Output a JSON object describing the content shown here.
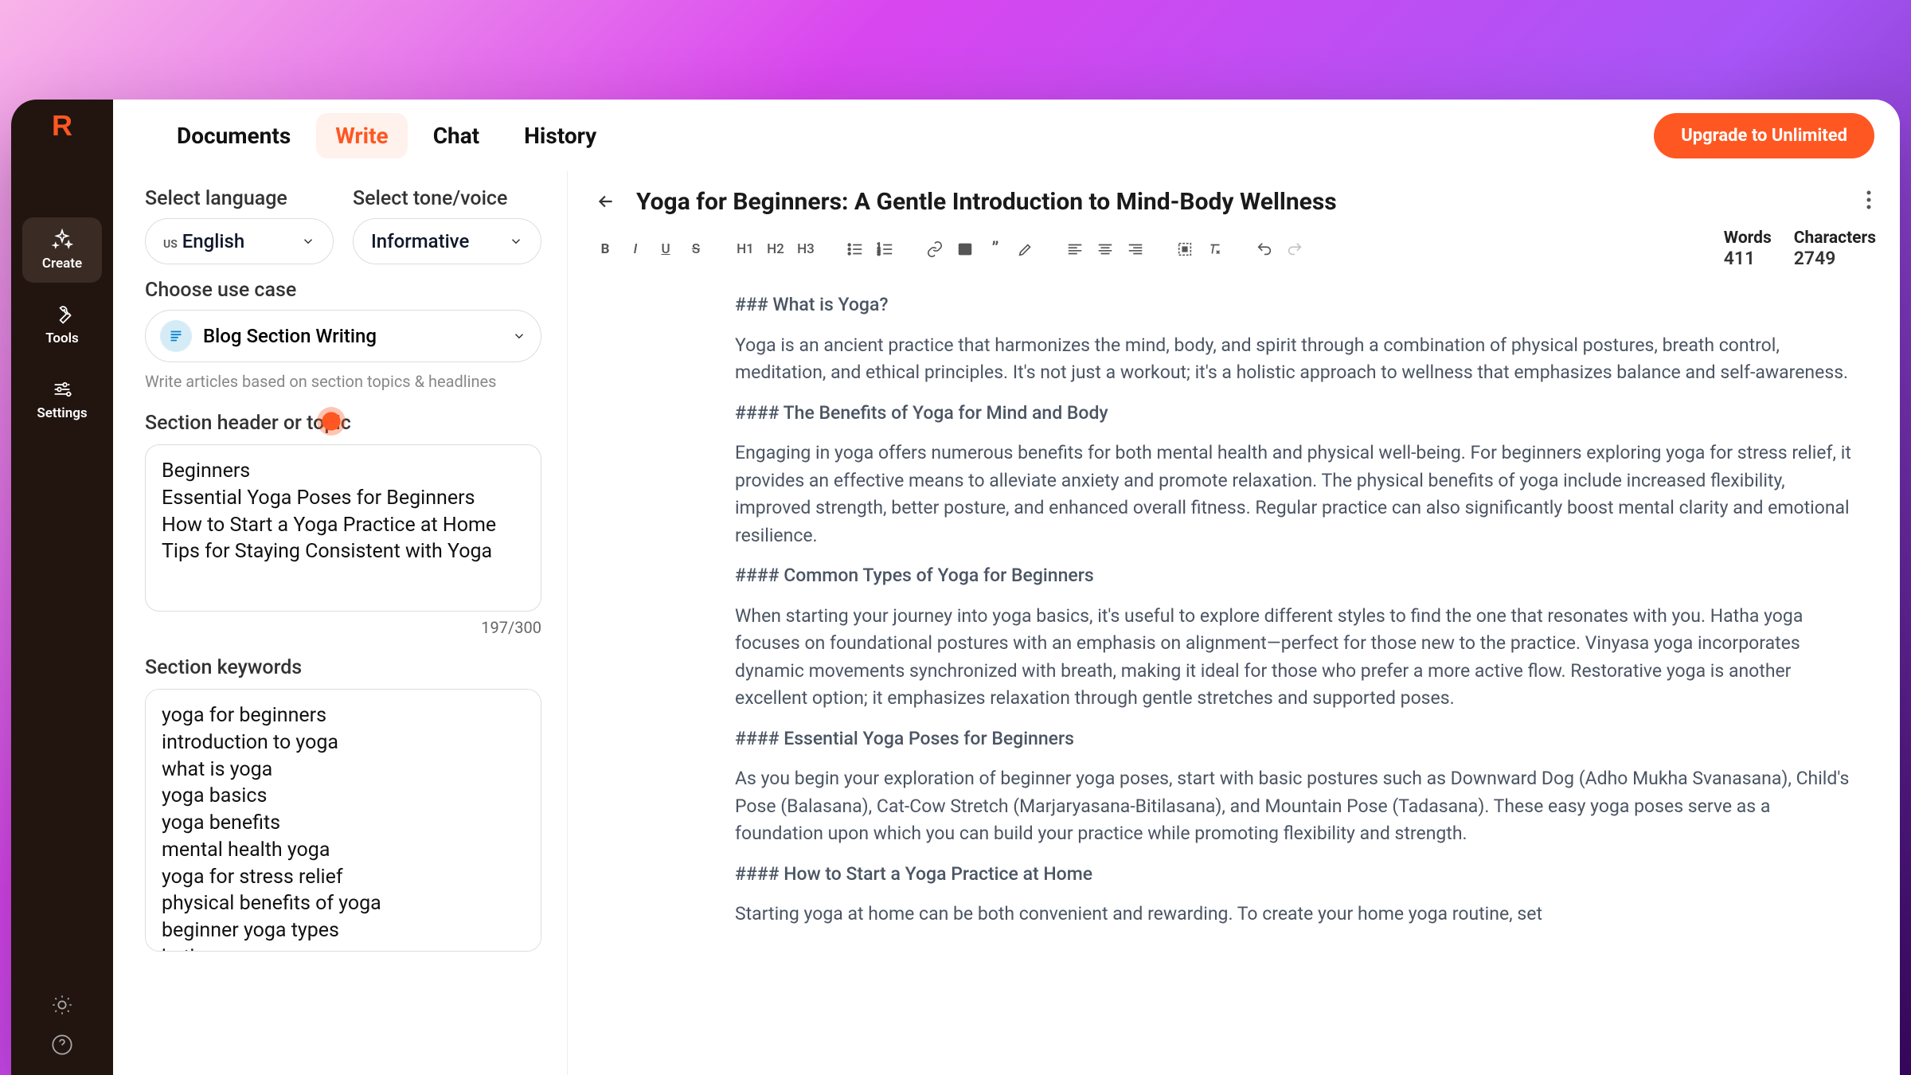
{
  "nav": {
    "documents": "Documents",
    "write": "Write",
    "chat": "Chat",
    "history": "History",
    "upgrade": "Upgrade to Unlimited"
  },
  "rail": {
    "create": "Create",
    "tools": "Tools",
    "settings": "Settings"
  },
  "panel": {
    "lang_label": "Select language",
    "tone_label": "Select tone/voice",
    "lang_flag": "US",
    "lang_value": "English",
    "tone_value": "Informative",
    "usecase_label": "Choose use case",
    "usecase_value": "Blog Section Writing",
    "usecase_helper": "Write articles based on section topics & headlines",
    "section_header_label": "Section header or topic",
    "section_header_value": "Beginners\nEssential Yoga Poses for Beginners\nHow to Start a Yoga Practice at Home\nTips for Staying Consistent with Yoga",
    "section_header_count": "197/300",
    "keywords_label": "Section keywords",
    "keywords_value": "yoga for beginners\nintroduction to yoga\nwhat is yoga\nyoga basics\nyoga benefits\nmental health yoga\nyoga for stress relief\nphysical benefits of yoga\nbeginner yoga types\nhatha yoga"
  },
  "editor": {
    "title": "Yoga for Beginners: A Gentle Introduction to Mind-Body Wellness",
    "words_label": "Words",
    "words": "411",
    "chars_label": "Characters",
    "chars": "2749",
    "body": [
      {
        "k": "h3",
        "t": "### What is Yoga?"
      },
      {
        "k": "p",
        "t": "Yoga is an ancient practice that harmonizes the mind, body, and spirit through a combination of physical postures, breath control, meditation, and ethical principles. It's not just a workout; it's a holistic approach to wellness that emphasizes balance and self-awareness."
      },
      {
        "k": "h4",
        "t": "#### The Benefits of Yoga for Mind and Body"
      },
      {
        "k": "p",
        "t": "Engaging in yoga offers numerous benefits for both mental health and physical well-being. For beginners exploring yoga for stress relief, it provides an effective means to alleviate anxiety and promote relaxation. The physical benefits of yoga include increased flexibility, improved strength, better posture, and enhanced overall fitness. Regular practice can also significantly boost mental clarity and emotional resilience."
      },
      {
        "k": "h4",
        "t": "#### Common Types of Yoga for Beginners"
      },
      {
        "k": "p",
        "t": "When starting your journey into yoga basics, it's useful to explore different styles to find the one that resonates with you. Hatha yoga focuses on foundational postures with an emphasis on alignment—perfect for those new to the practice. Vinyasa yoga incorporates dynamic movements synchronized with breath, making it ideal for those who prefer a more active flow. Restorative yoga is another excellent option; it emphasizes relaxation through gentle stretches and supported poses."
      },
      {
        "k": "h4",
        "t": "#### Essential Yoga Poses for Beginners"
      },
      {
        "k": "p",
        "t": "As you begin your exploration of beginner yoga poses, start with basic postures such as Downward Dog (Adho Mukha Svanasana), Child's Pose (Balasana), Cat-Cow Stretch (Marjaryasana-Bitilasana), and Mountain Pose (Tadasana). These easy yoga poses serve as a foundation upon which you can build your practice while promoting flexibility and strength."
      },
      {
        "k": "h4",
        "t": "#### How to Start a Yoga Practice at Home"
      },
      {
        "k": "p",
        "t": "Starting yoga at home can be both convenient and rewarding. To create your home yoga routine, set"
      }
    ]
  }
}
